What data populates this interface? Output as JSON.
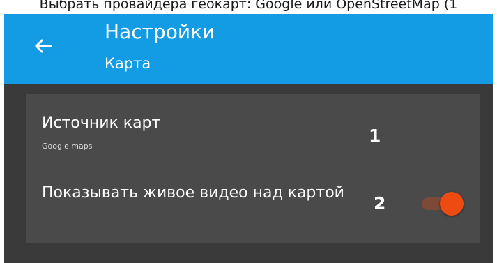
{
  "caption": "Выбрать провайдера геокарт: Google или OpenStreetMap (1",
  "app_bar": {
    "back_icon": "arrow-left-icon",
    "title": "Настройки",
    "subtitle": "Карта"
  },
  "settings": {
    "map_source": {
      "title": "Источник карт",
      "value": "Google maps",
      "marker": "1"
    },
    "live_video": {
      "title": "Показывать живое видео над картой",
      "marker": "2",
      "enabled": true
    }
  },
  "colors": {
    "app_bar": "#139be4",
    "background": "#3a3a3a",
    "card": "#4a4a4a",
    "switch_thumb": "#ee4b12",
    "switch_track": "#7d4a38"
  }
}
